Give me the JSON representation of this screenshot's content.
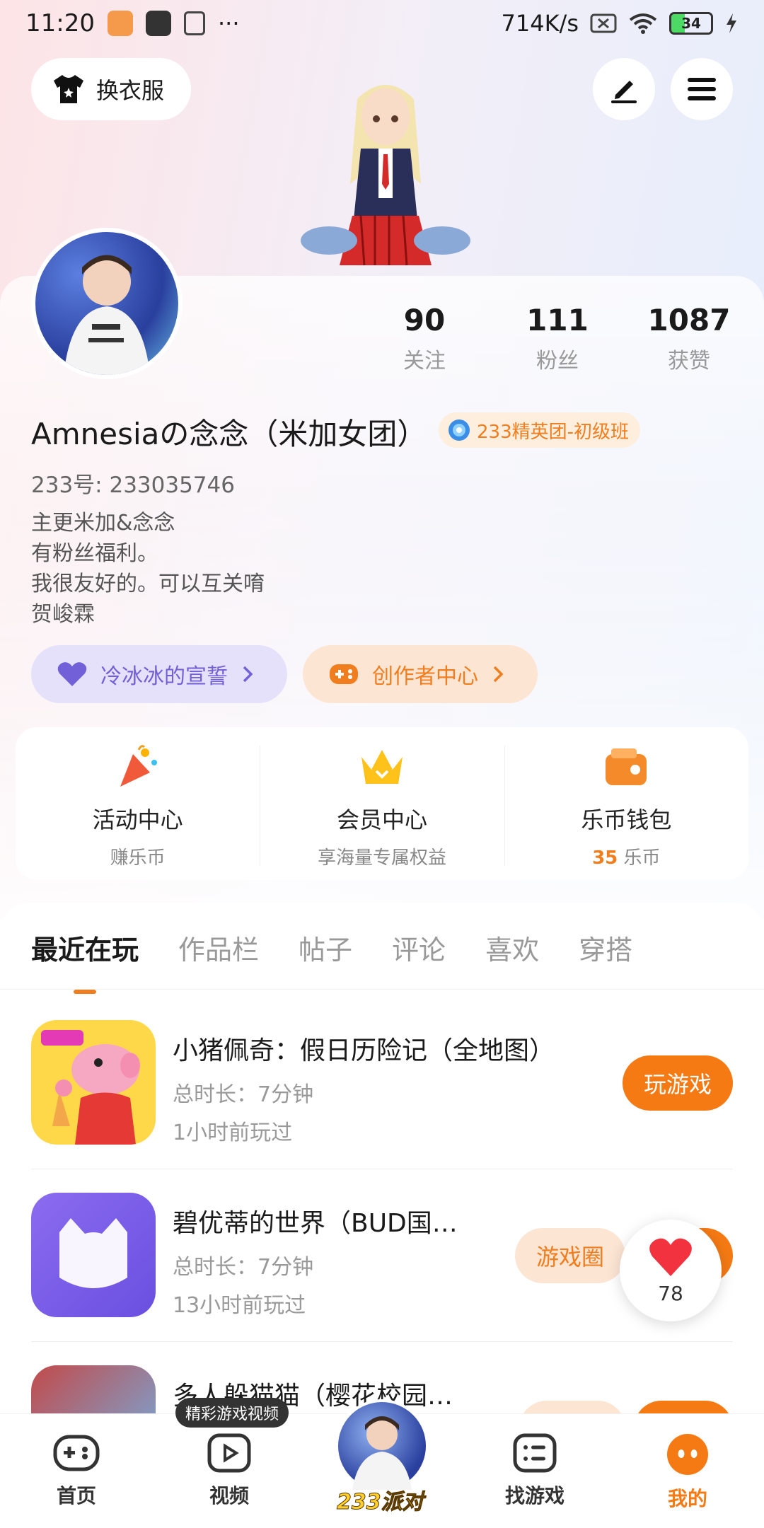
{
  "status_bar": {
    "time": "11:20",
    "dots": "···",
    "speed": "714K/s",
    "battery": "34"
  },
  "header": {
    "wardrobe_label": "换衣服"
  },
  "profile": {
    "stats": [
      {
        "num": "90",
        "label": "关注"
      },
      {
        "num": "111",
        "label": "粉丝"
      },
      {
        "num": "1087",
        "label": "获赞"
      }
    ],
    "username": "Amnesiaの念念（米加女团）",
    "rank_badge": "233精英团-初级班",
    "uid": "233号: 233035746",
    "bio": [
      "主更米加&念念",
      "有粉丝福利。",
      "我很友好的。可以互关唷",
      "贺峻霖"
    ],
    "pill_left": "冷冰冰的宣誓",
    "pill_right": "创作者中心"
  },
  "services": [
    {
      "title": "活动中心",
      "sub": "赚乐币"
    },
    {
      "title": "会员中心",
      "sub": "享海量专属权益"
    },
    {
      "title": "乐币钱包",
      "sub_value": "35",
      "sub_unit": "乐币"
    }
  ],
  "tabs": [
    "最近在玩",
    "作品栏",
    "帖子",
    "评论",
    "喜欢",
    "穿搭"
  ],
  "games": [
    {
      "title": "小猪佩奇：假日历险记（全地图）",
      "duration": "总时长：7分钟",
      "last_played": "1小时前玩过",
      "action": "玩游戏"
    },
    {
      "title": "碧优蒂的世界（BUD国…",
      "duration": "总时长：7分钟",
      "last_played": "13小时前玩过",
      "circle": "游戏圈"
    },
    {
      "title": "多人躲猫猫（樱花校园…"
    }
  ],
  "like_float": {
    "count": "78"
  },
  "bottom_nav": {
    "video_tip": "精彩游戏视频",
    "items": [
      {
        "label": "首页"
      },
      {
        "label": "视频"
      },
      {
        "label": "233派对"
      },
      {
        "label": "找游戏"
      },
      {
        "label": "我的"
      }
    ]
  },
  "colors": {
    "accent": "#f57a14",
    "purple": "#7260d8"
  }
}
